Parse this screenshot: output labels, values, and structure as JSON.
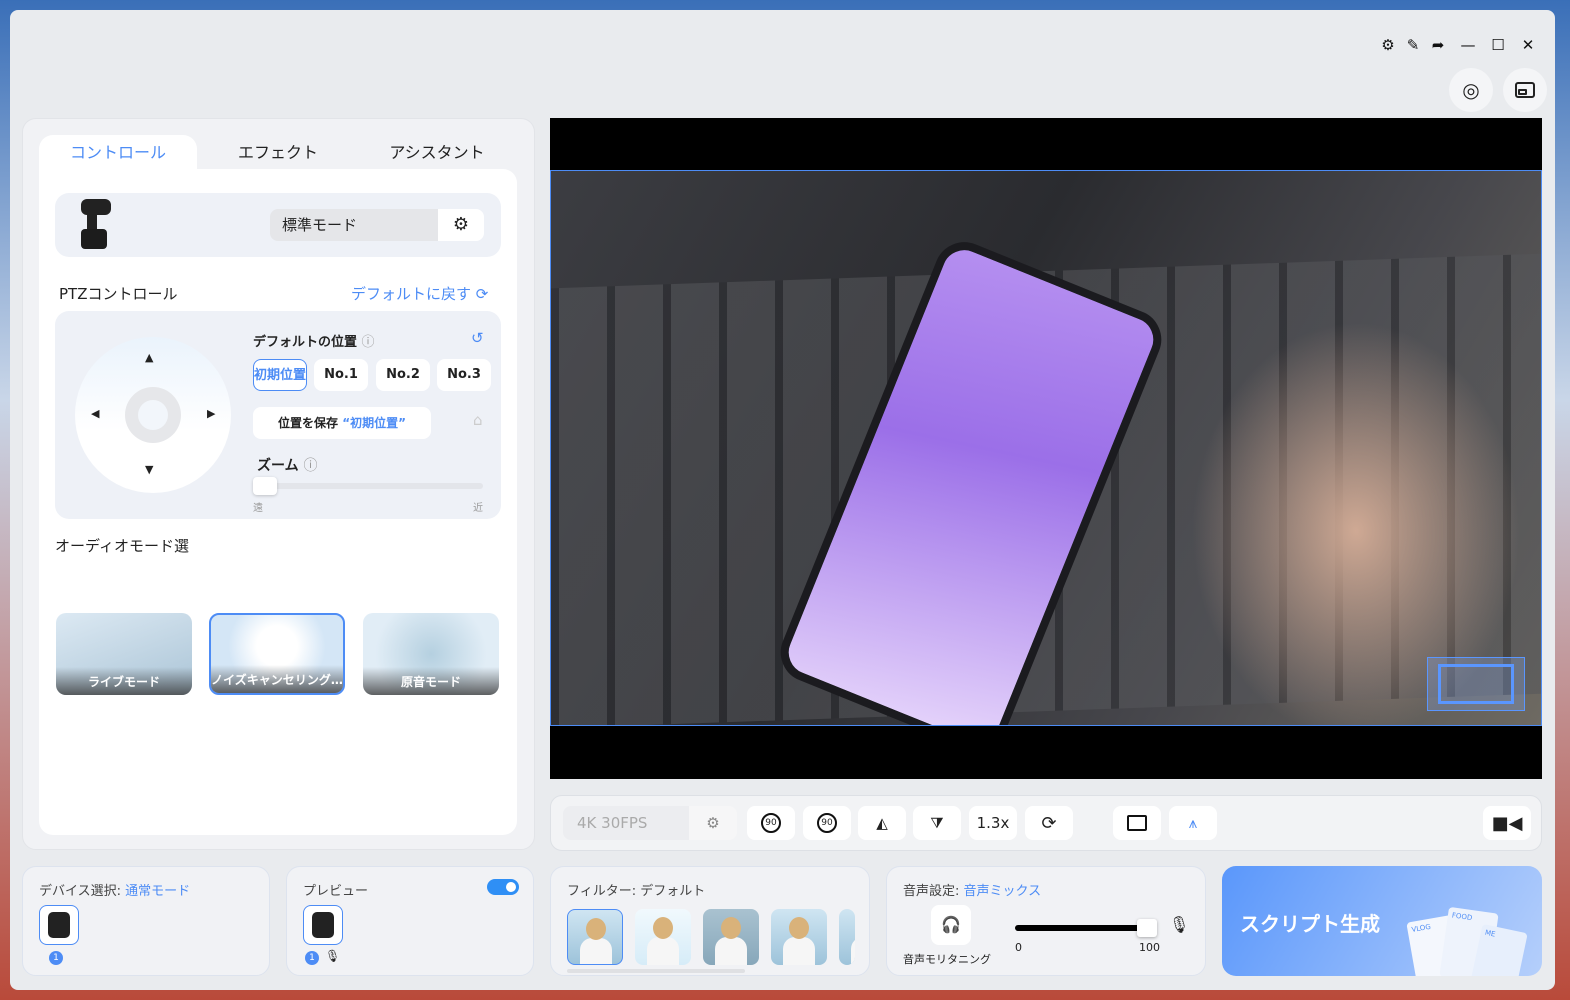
{
  "titlebar": {
    "icons": [
      "gear-icon",
      "pin-icon",
      "share-icon",
      "minimize-icon",
      "maximize-icon",
      "close-icon"
    ]
  },
  "top_buttons": [
    "webcam-icon",
    "picture-in-picture-icon"
  ],
  "tabs": [
    {
      "label": "コントロール",
      "active": true
    },
    {
      "label": "エフェクト"
    },
    {
      "label": "アシスタント"
    }
  ],
  "device": {
    "mode": "標準モード"
  },
  "ptz": {
    "title": "PTZコントロール",
    "reset": "デフォルトに戻す",
    "default_pos_title": "デフォルトの位置",
    "positions": [
      "初期位置",
      "No.1",
      "No.2",
      "No.3"
    ],
    "selected": "初期位置",
    "save_prefix": "位置を保存",
    "save_target": "“初期位置”",
    "zoom_title": "ズーム",
    "zoom_far": "遠",
    "zoom_near": "近",
    "zoom_value": 0
  },
  "audio_modes": {
    "title": "オーディオモード選",
    "items": [
      "ライブモード",
      "ノイズキャンセリング…",
      "原音モード"
    ],
    "selected": "ノイズキャンセリング…"
  },
  "toolbar": {
    "resolution": "4K 30FPS",
    "zoom": "1.3x",
    "rot_left": "90",
    "rot_right": "90"
  },
  "device_select": {
    "label": "デバイス選択:",
    "value": "通常モード",
    "count": "1"
  },
  "preview": {
    "label": "プレビュー",
    "enabled": true,
    "count": "1"
  },
  "filter": {
    "label": "フィルター:",
    "value": "デフォルト"
  },
  "voice": {
    "label": "音声設定:",
    "value": "音声ミックス",
    "monitor": "音声モリタニング",
    "min": "0",
    "max": "100",
    "value_level": 100
  },
  "script": {
    "label": "スクリプト生成",
    "cards": [
      "VLOG",
      "FOOD",
      "ME"
    ]
  },
  "colors": {
    "accent": "#4d8cf5",
    "window": "#e9ebee"
  }
}
